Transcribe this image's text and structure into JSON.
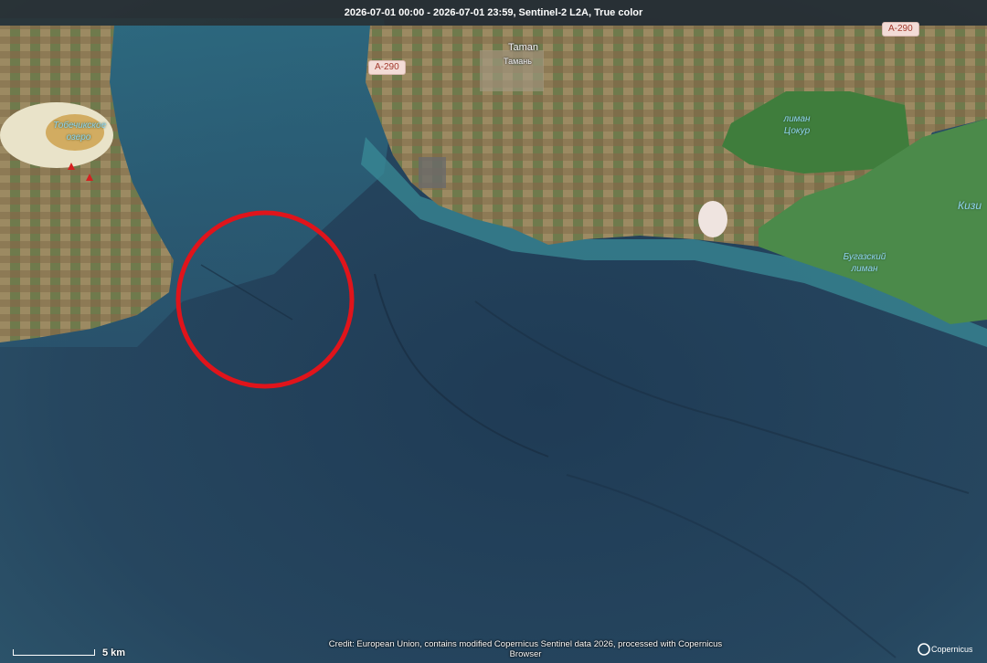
{
  "header": {
    "title": "2026-07-01 00:00 - 2026-07-01 23:59, Sentinel-2 L2A, True color"
  },
  "roads": [
    {
      "label": "A-290"
    },
    {
      "label": "A-290"
    }
  ],
  "places": {
    "taman_en": "Taman",
    "taman_ru": "Тамань",
    "lake_tobechik": "Тобечикское озеро",
    "liman_tsokur": "лиман Цокур",
    "liman_bugazsky": "Бугазский лиман",
    "kiz_partial": "Кизи"
  },
  "annotation": {
    "marker_color": "#e0141b"
  },
  "footer": {
    "credit": "Credit: European Union, contains modified Copernicus Sentinel data 2026, processed with Copernicus Browser",
    "scale_label": "5 km",
    "logo_text": "Copernicus"
  },
  "colors": {
    "sea_deep": "#22405a",
    "sea_shallow": "#2f8a9a",
    "land": "#8a7a52",
    "liman": "#3f7d3c"
  }
}
